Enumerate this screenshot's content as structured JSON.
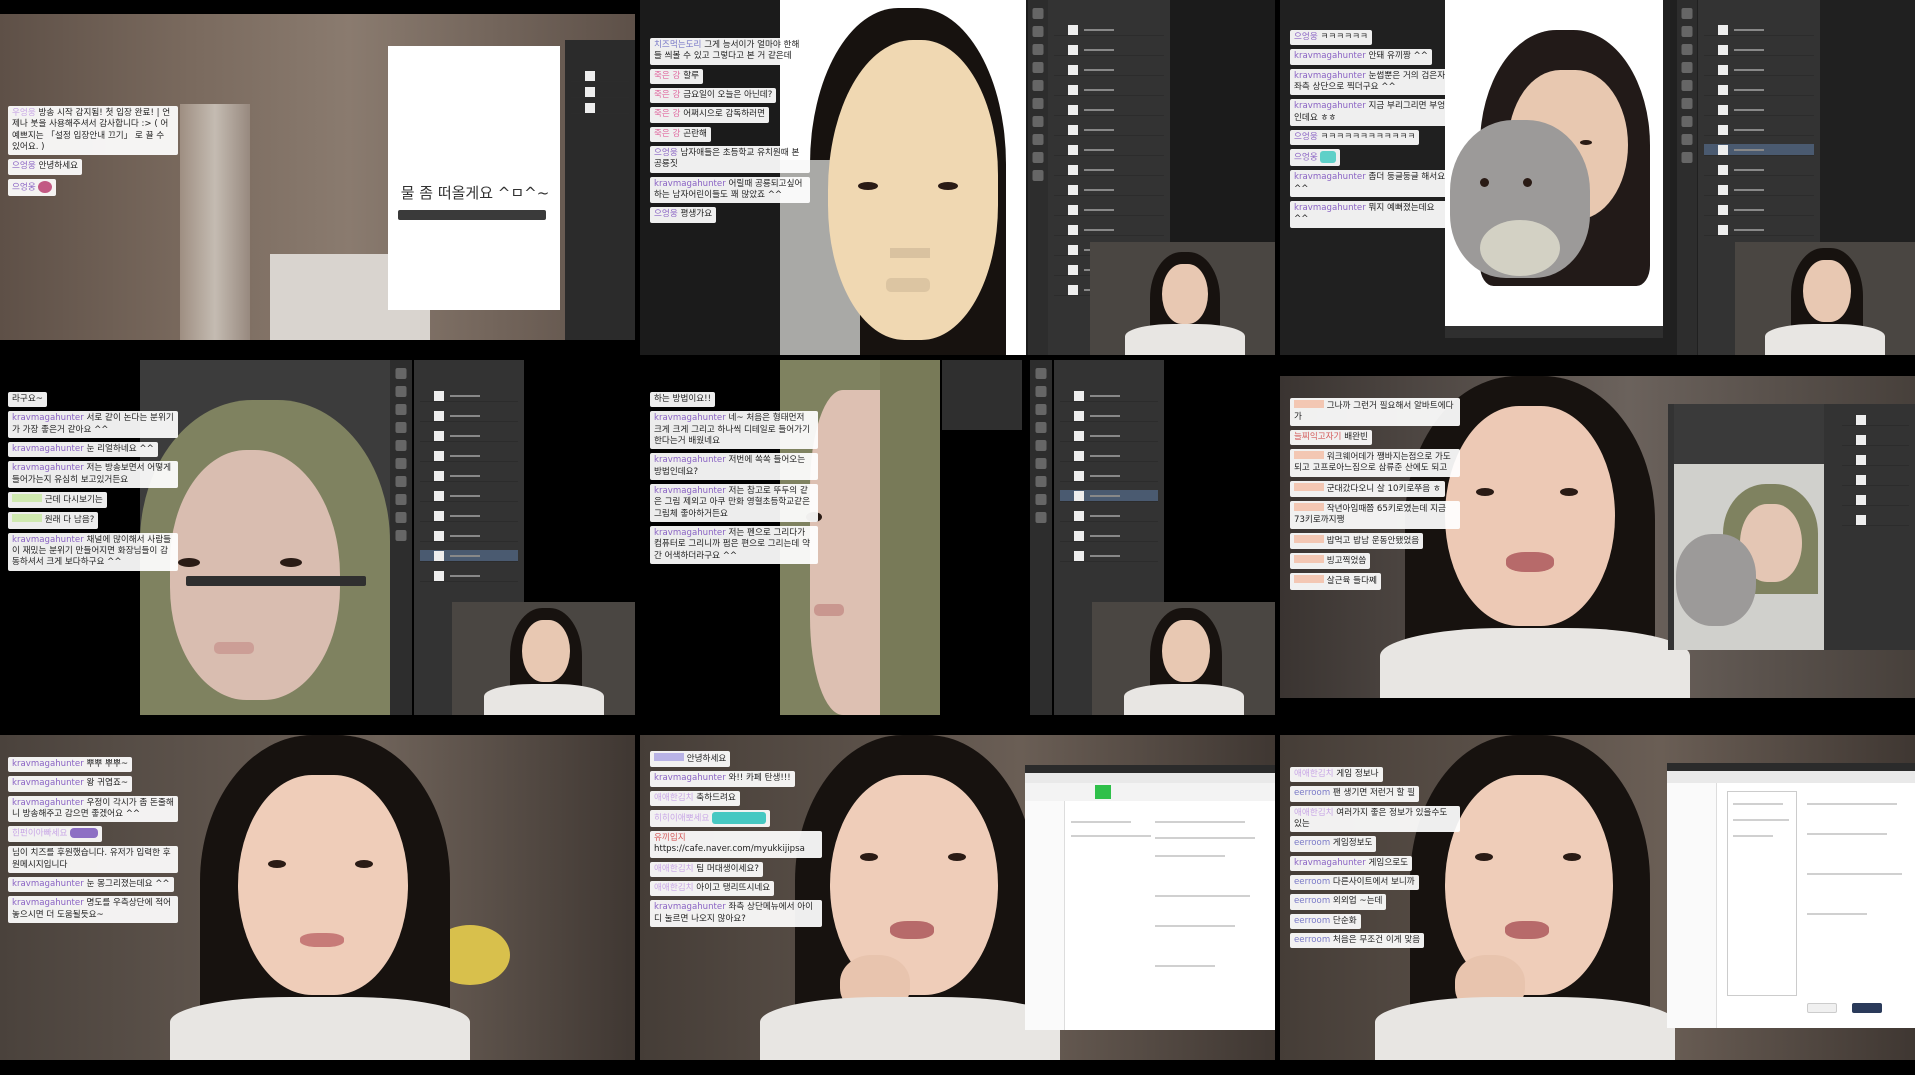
{
  "tile1": {
    "chat": [
      {
        "user": "우엉웅",
        "text": "방송 시작 감지됨! 첫 입장 완료! | 언제나 붓을 사용해주셔서 감사합니다 :> ( 어 예쁘지는 「설정 입장안내 끄기」 로 끌 수 있어요. )"
      },
      {
        "user": "으엉웅",
        "text": "안녕하세요"
      },
      {
        "user": "으엉웅",
        "text": ""
      }
    ],
    "canvas_text": "물 좀 떠올게요 ^ㅁ^~"
  },
  "tile2": {
    "chat": [
      {
        "user": "치즈먹는도리",
        "text": "그게 능서이가 얼마야 한해들 씌볼 수 있고 그렇다고 본 거 같은데"
      },
      {
        "user": "죽은 강",
        "text": "할루"
      },
      {
        "user": "죽은 강",
        "text": "금요일이 오늘은 아닌데?"
      },
      {
        "user": "죽은 강",
        "text": "어쩌시으로 감독하러면"
      },
      {
        "user": "죽은 강",
        "text": "곤란해"
      },
      {
        "user": "으엉웅",
        "text": "남자애들은 초등학교 유치원때 본 공룡짓"
      },
      {
        "user": "kravmagahunter",
        "text": "어릴때 공룡되고싶어하는 남자어린이들도 꽤 많았죠 ^^"
      },
      {
        "user": "으엉웅",
        "text": "평생가요"
      }
    ]
  },
  "tile3": {
    "chat": [
      {
        "user": "으엉웅",
        "text": "ㅋㅋㅋㅋㅋㅋ"
      },
      {
        "user": "kravmagahunter",
        "text": "안돼 유끼짱 ^^"
      },
      {
        "user": "kravmagahunter",
        "text": "눈썹뿐은 거의 검은자 좌측 상단으로 찍더구요 ^^"
      },
      {
        "user": "kravmagahunter",
        "text": "지금 부리그리면 부엉인데요 ㅎㅎ"
      },
      {
        "user": "으엉웅",
        "text": "ㅋㅋㅋㅋㅋㅋㅋㅋㅋㅋㅋㅋ"
      },
      {
        "user": "으엉웅",
        "text": ""
      },
      {
        "user": "kravmagahunter",
        "text": "좀더 둥글둥글 해서요 ^^"
      },
      {
        "user": "kravmagahunter",
        "text": "뭐지 예뻐졌는데요 ^^"
      }
    ]
  },
  "tile4": {
    "chat": [
      {
        "user": "",
        "text": "라구요~"
      },
      {
        "user": "kravmagahunter",
        "text": "서로 같이 논다는 분위기가 가장 좋은거 같아요 ^^"
      },
      {
        "user": "kravmagahunter",
        "text": "눈 리얼하네요 ^^"
      },
      {
        "user": "kravmagahunter",
        "text": "저는 방송보면서 어떻게 들어가는지 유심히 보고있거든요"
      },
      {
        "user": "",
        "text": "근데 다시보기는"
      },
      {
        "user": "",
        "text": "원래 다 남음?"
      },
      {
        "user": "kravmagahunter",
        "text": "채널에 많이해서 사람들이 재밌는 분위기 만들어지면 화장님들이 감동하셔서 크게 보다하구요 ^^"
      }
    ]
  },
  "tile5": {
    "chat": [
      {
        "user": "",
        "text": "하는 방법이요!!"
      },
      {
        "user": "kravmagahunter",
        "text": "네~ 처음은 형태먼저 크게 크게 그리고 하나씩 디테일로 들어가기한다는거 배웠네요"
      },
      {
        "user": "kravmagahunter",
        "text": "저번에 쏙쏙 들어오는 방법인데요?"
      },
      {
        "user": "kravmagahunter",
        "text": "저는 참고로 뚜두의 같은 그림 제외고 아쿠 만화 영혈초등학교같은 그림체 좋아하거든요"
      },
      {
        "user": "kravmagahunter",
        "text": "저는 펜으로 그리다가 컴퓨터로 그리니까 펌은 편으로 그리는데 약간 어색하더라구요 ^^"
      }
    ]
  },
  "tile6": {
    "chat": [
      {
        "user": "",
        "text": "그나까 그런거 필요해서 알바트에다가"
      },
      {
        "user": "늘찌익고자기",
        "text": "배완빈"
      },
      {
        "user": "",
        "text": "워크웨어데가 쨍바지는점으로 가도 되고 고프로아느짐으로 삼류준 산에도 되고"
      },
      {
        "user": "",
        "text": "군대갔다오니 살 10키로쭈음 ㅎ"
      },
      {
        "user": "",
        "text": "작년아임때쯤 65키로였는데 지금 73키로까지쨍"
      },
      {
        "user": "",
        "text": "밥먹고 밥남 운동안됐었음"
      },
      {
        "user": "",
        "text": "빙고찍었씀"
      },
      {
        "user": "",
        "text": "살근육 들다쩨"
      }
    ]
  },
  "tile7": {
    "chat": [
      {
        "user": "kravmagahunter",
        "text": "뿌뿌 뿌뿌~"
      },
      {
        "user": "kravmagahunter",
        "text": "왕 귀엽죠~"
      },
      {
        "user": "kravmagahunter",
        "text": "우정이 각시가 좀 돈줄해니 방송해주고 감으면 좋겠어요 ^^"
      },
      {
        "user": "힌펀이아빠세요",
        "text": ""
      },
      {
        "user": "",
        "text": "님이 치즈를 후원했습니다. 유저가 입력한 후원메시지입니다"
      },
      {
        "user": "kravmagahunter",
        "text": "눈 몽그리졌는데요 ^^"
      },
      {
        "user": "kravmagahunter",
        "text": "명도를 우측상단에 적어놓으시면 더 도움될듯요~"
      }
    ]
  },
  "tile8": {
    "chat": [
      {
        "user": "",
        "text": "안녕하세요"
      },
      {
        "user": "kravmagahunter",
        "text": "와!! 카페 탄생!!!"
      },
      {
        "user": "애애한김치",
        "text": "축하드려요"
      },
      {
        "user": "히히이애뽀세요",
        "text": ""
      },
      {
        "user": "유끼입지",
        "text": "https://cafe.naver.com/myukkijipsa"
      },
      {
        "user": "애애한김치",
        "text": "팀 머대생이세요?"
      },
      {
        "user": "애애한김치",
        "text": "아이고 탱리뜨시네요"
      },
      {
        "user": "kravmagahunter",
        "text": "좌측 상단메뉴에서 아이디 눌르면 나오지 않아요?"
      }
    ]
  },
  "tile9": {
    "chat": [
      {
        "user": "애애한김치",
        "text": "게임 정보나"
      },
      {
        "user": "eerroom",
        "text": "팬 생기면 저런거 할 필"
      },
      {
        "user": "애애한김치",
        "text": "여러가지 좋은 정보가 있을수도 있는"
      },
      {
        "user": "eerroom",
        "text": "게임정보도"
      },
      {
        "user": "kravmagahunter",
        "text": "게임으로도"
      },
      {
        "user": "eerroom",
        "text": "다른사이트에서 보니까"
      },
      {
        "user": "eerroom",
        "text": "외외업 ~는데"
      },
      {
        "user": "eerroom",
        "text": "단순화"
      },
      {
        "user": "eerroom",
        "text": "처음은 무조건 이게 맞음"
      }
    ]
  }
}
